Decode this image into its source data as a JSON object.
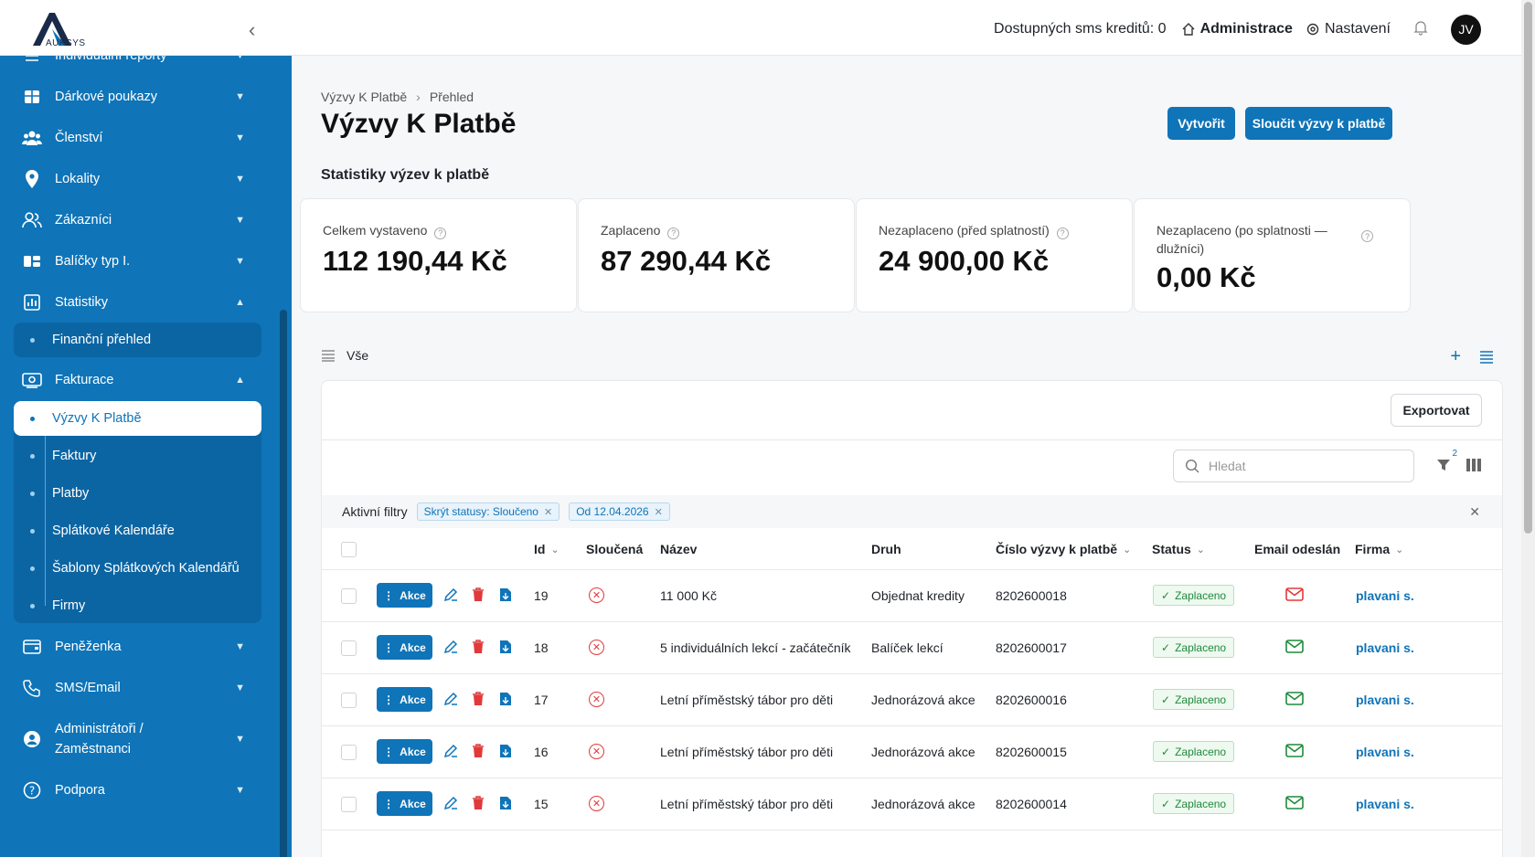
{
  "topbar": {
    "logo_text": "AUKSYS",
    "credits": "Dostupných sms kreditů: 0",
    "admin": "Administrace",
    "settings": "Nastavení",
    "avatar": "JV"
  },
  "sidebar": {
    "partial_top": "Individuální reporty",
    "items": [
      {
        "label": "Dárkové poukazy",
        "icon": "gift-card-icon"
      },
      {
        "label": "Členství",
        "icon": "group-icon"
      },
      {
        "label": "Lokality",
        "icon": "location-pin-icon"
      },
      {
        "label": "Zákazníci",
        "icon": "customers-icon"
      },
      {
        "label": "Balíčky typ I.",
        "icon": "packages-icon"
      },
      {
        "label": "Statistiky",
        "icon": "chart-icon"
      },
      {
        "label": "Fakturace",
        "icon": "invoice-icon"
      },
      {
        "label": "Peněženka",
        "icon": "wallet-icon"
      },
      {
        "label": "SMS/Email",
        "icon": "phone-icon"
      },
      {
        "label": "Administrátoři / Zaměstnanci",
        "icon": "user-icon"
      },
      {
        "label": "Podpora",
        "icon": "help-icon"
      }
    ],
    "statistiky_sub": [
      "Finanční přehled"
    ],
    "fakturace_sub": [
      "Výzvy K Platbě",
      "Faktury",
      "Platby",
      "Splátkové Kalendáře",
      "Šablony Splátkových Kalendářů",
      "Firmy"
    ]
  },
  "main": {
    "breadcrumb": [
      "Výzvy K Platbě",
      "Přehled"
    ],
    "title": "Výzvy K Platbě",
    "create_button": "Vytvořit",
    "merge_button": "Sloučit výzvy k platbě",
    "stats_title": "Statistiky výzev k platbě",
    "stats": [
      {
        "label": "Celkem vystaveno",
        "value": "112 190,44 Kč"
      },
      {
        "label": "Zaplaceno",
        "value": "87 290,44 Kč"
      },
      {
        "label": "Nezaplaceno (před splatností)",
        "value": "24 900,00 Kč"
      },
      {
        "label": "Nezaplaceno (po splatnosti — dlužníci)",
        "value": "0,00 Kč"
      }
    ],
    "view_label": "Vše",
    "export_button": "Exportovat",
    "search_placeholder": "Hledat",
    "filter_count": "2",
    "active_filters_label": "Aktivní filtry",
    "filters": [
      "Skrýt statusy: Sloučeno",
      "Od 12.04.2026"
    ],
    "columns": {
      "id": "Id",
      "merged": "Sloučená",
      "name": "Název",
      "type": "Druh",
      "number": "Číslo výzvy k platbě",
      "status": "Status",
      "email": "Email odeslán",
      "firma": "Firma"
    },
    "action_label": "Akce",
    "rows": [
      {
        "id": "19",
        "name": "11 000 Kč",
        "type": "Objednat kredity",
        "number": "8202600018",
        "status": "Zaplaceno",
        "email_sent": false,
        "firma": "plavani s.r.o."
      },
      {
        "id": "18",
        "name": "5 individuálních lekcí - začátečník",
        "type": "Balíček lekcí",
        "number": "8202600017",
        "status": "Zaplaceno",
        "email_sent": true,
        "firma": "plavani s.r.o."
      },
      {
        "id": "17",
        "name": "Letní příměstský tábor pro děti",
        "type": "Jednorázová akce",
        "number": "8202600016",
        "status": "Zaplaceno",
        "email_sent": true,
        "firma": "plavani s.r.o."
      },
      {
        "id": "16",
        "name": "Letní příměstský tábor pro děti",
        "type": "Jednorázová akce",
        "number": "8202600015",
        "status": "Zaplaceno",
        "email_sent": true,
        "firma": "plavani s.r.o."
      },
      {
        "id": "15",
        "name": "Letní příměstský tábor pro děti",
        "type": "Jednorázová akce",
        "number": "8202600014",
        "status": "Zaplaceno",
        "email_sent": true,
        "firma": "plavani s.r.o."
      }
    ]
  },
  "colors": {
    "primary": "#0f74b8",
    "success": "#1f8a3a",
    "danger": "#e03a3a"
  }
}
